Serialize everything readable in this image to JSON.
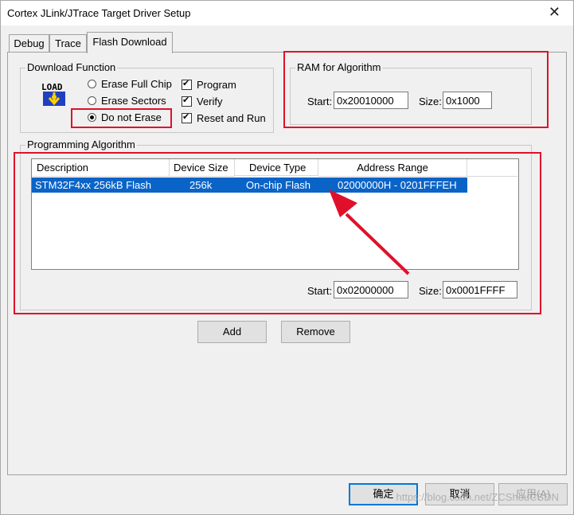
{
  "window": {
    "title": "Cortex JLink/JTrace Target Driver Setup",
    "close_glyph": "✕"
  },
  "tabs": [
    {
      "label": "Debug"
    },
    {
      "label": "Trace"
    },
    {
      "label": "Flash Download",
      "active": true
    }
  ],
  "download_function": {
    "label": "Download Function",
    "icon": "load-icon",
    "options": [
      {
        "label": "Erase Full Chip",
        "selected": false
      },
      {
        "label": "Erase Sectors",
        "selected": false
      },
      {
        "label": "Do not Erase",
        "selected": true
      }
    ],
    "checks": [
      {
        "label": "Program",
        "checked": true
      },
      {
        "label": "Verify",
        "checked": true
      },
      {
        "label": "Reset and Run",
        "checked": true
      }
    ]
  },
  "ram_for_algorithm": {
    "label": "RAM for Algorithm",
    "start_label": "Start:",
    "start_value": "0x20010000",
    "size_label": "Size:",
    "size_value": "0x1000"
  },
  "programming_algorithm": {
    "label": "Programming Algorithm",
    "columns": [
      "Description",
      "Device Size",
      "Device Type",
      "Address Range"
    ],
    "rows": [
      {
        "description": "STM32F4xx 256kB Flash",
        "device_size": "256k",
        "device_type": "On-chip Flash",
        "address_range": "02000000H - 0201FFFEH",
        "selected": true
      }
    ],
    "start_label": "Start:",
    "start_value": "0x02000000",
    "size_label": "Size:",
    "size_value": "0x0001FFFF"
  },
  "buttons": {
    "add": "Add",
    "remove": "Remove",
    "ok": "确定",
    "cancel": "取消",
    "apply": "应用(A)"
  },
  "watermark": "https://blog.csdn.net/ZCShouCSDN",
  "colors": {
    "highlight": "#0a64c8",
    "annotation_red": "#e0102a",
    "default_button_border": "#0078d7"
  }
}
